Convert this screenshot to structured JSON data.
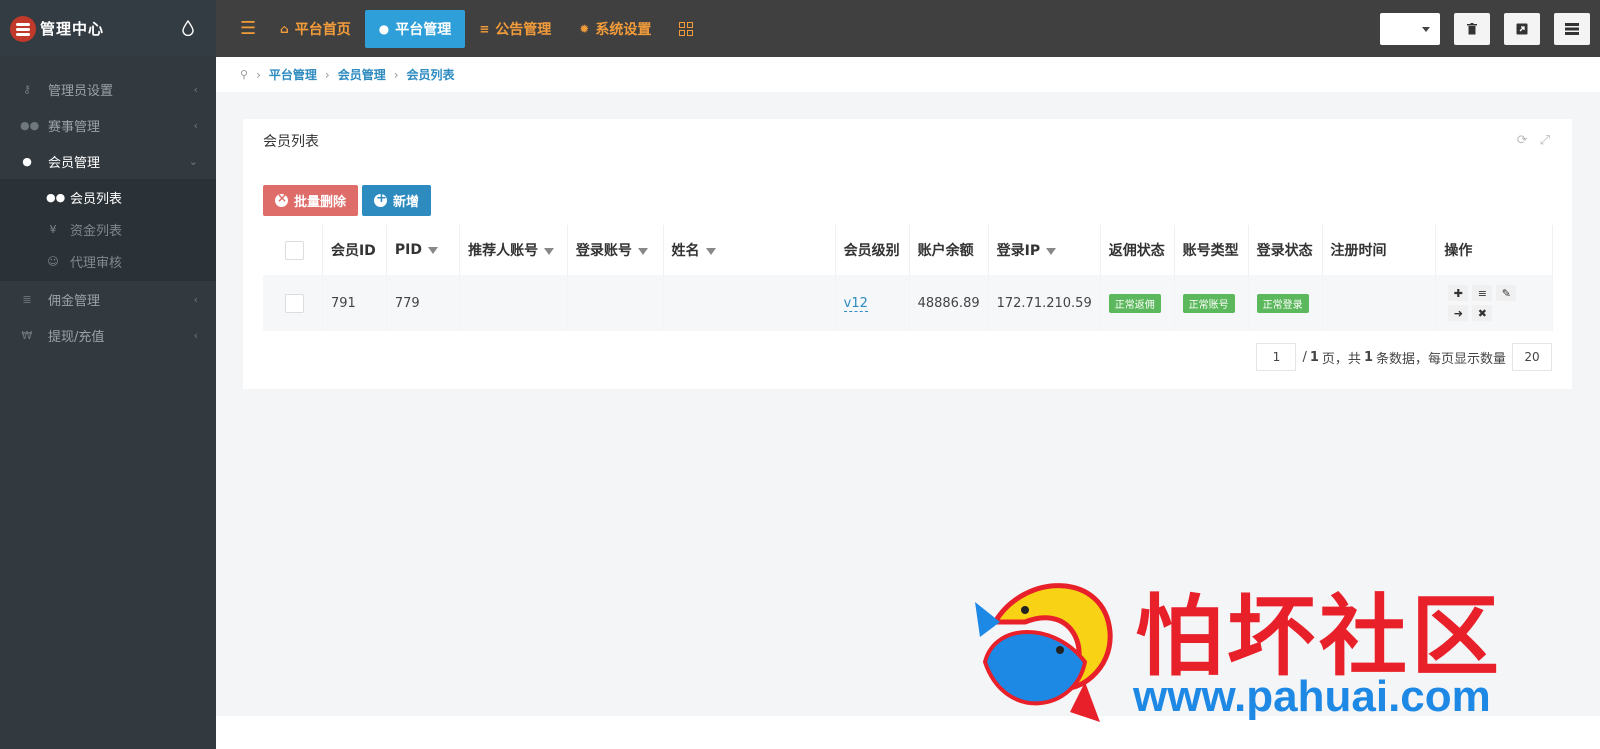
{
  "header": {
    "app_title": "管理中心",
    "nav": [
      {
        "label": "平台首页",
        "active": false
      },
      {
        "label": "平台管理",
        "active": true
      },
      {
        "label": "公告管理",
        "active": false
      },
      {
        "label": "系统设置",
        "active": false
      }
    ],
    "accent_color": "#2e9fd8",
    "nav_color": "#f39c3a"
  },
  "sidebar": {
    "items": [
      {
        "label": "管理员设置",
        "icon": "key-icon"
      },
      {
        "label": "赛事管理",
        "icon": "group-icon"
      },
      {
        "label": "会员管理",
        "icon": "user-icon",
        "open": true
      },
      {
        "label": "佣金管理",
        "icon": "stack-icon"
      },
      {
        "label": "提现/充值",
        "icon": "yen-icon"
      }
    ],
    "submenu": [
      {
        "label": "会员列表",
        "icon": "users-icon",
        "active": true
      },
      {
        "label": "资金列表",
        "icon": "yen-icon"
      },
      {
        "label": "代理审核",
        "icon": "user-check-icon"
      }
    ]
  },
  "breadcrumb": [
    "平台管理",
    "会员管理",
    "会员列表"
  ],
  "panel": {
    "title": "会员列表",
    "batch_delete_label": "批量删除",
    "add_label": "新增"
  },
  "table": {
    "columns": [
      "会员ID",
      "PID",
      "推荐人账号",
      "登录账号",
      "姓名",
      "会员级别",
      "账户余额",
      "登录IP",
      "返佣状态",
      "账号类型",
      "登录状态",
      "注册时间",
      "操作"
    ],
    "rows": [
      {
        "id": "791",
        "pid": "779",
        "referrer": "",
        "login_account": "",
        "name": "",
        "level": "v12",
        "balance": "48886.89",
        "ip": "172.71.210.59",
        "rebate_status": "正常返佣",
        "account_type": "正常账号",
        "login_status": "正常登录",
        "register_time": ""
      }
    ]
  },
  "pager": {
    "current_page": "1",
    "total_pages": "1",
    "page_unit": "页，共",
    "total_count": "1",
    "count_suffix": "条数据，每页显示数量",
    "page_size": "20"
  },
  "watermark": {
    "text": "怕坏社区",
    "url": "www.pahuai.com"
  }
}
